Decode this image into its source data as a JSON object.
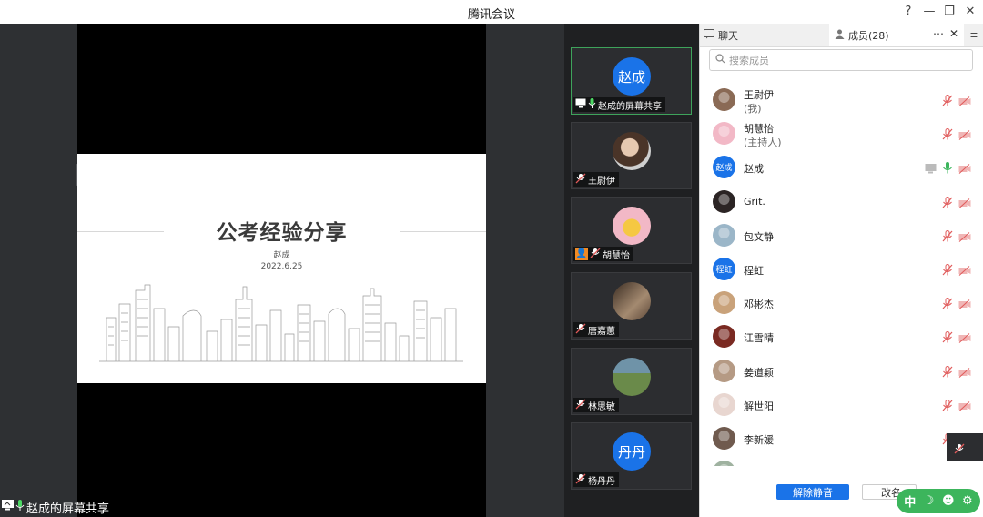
{
  "window": {
    "title": "腾讯会议"
  },
  "slide": {
    "title": "公考经验分享",
    "author": "赵成",
    "date": "2022.6.25"
  },
  "share_label": "赵成的屏幕共享",
  "gallery": [
    {
      "name": "赵成的屏幕共享",
      "avatar_text": "赵成",
      "avatar_color": "#1a73e8",
      "kind": "initials",
      "active": true,
      "mic": "on",
      "screen_icon": true
    },
    {
      "name": "王尉伊",
      "kind": "photo",
      "photo_color": "#8a6a55",
      "mic": "muted"
    },
    {
      "name": "胡慧怡",
      "kind": "photo",
      "photo_color": "#f2b8c6",
      "mic": "muted",
      "person_icon": true
    },
    {
      "name": "唐嘉蕙",
      "kind": "photo",
      "photo_color": "#6d5744",
      "mic": "muted"
    },
    {
      "name": "林思敏",
      "kind": "photo",
      "photo_color": "#8aa6b6",
      "mic": "muted"
    },
    {
      "name": "杨丹丹",
      "avatar_text": "丹丹",
      "avatar_color": "#1a73e8",
      "kind": "initials",
      "mic": "muted"
    }
  ],
  "panel": {
    "tab_chat": "聊天",
    "tab_members": "成员(28)",
    "more_icon": "more-icon",
    "search_placeholder": "搜索成员",
    "members": [
      {
        "name": "王尉伊",
        "sub": "(我)",
        "kind": "photo",
        "color": "#8a6a55",
        "mic": "muted",
        "cam": "off"
      },
      {
        "name": "胡慧怡",
        "sub": "(主持人)",
        "kind": "photo",
        "color": "#f2b8c6",
        "mic": "muted",
        "cam": "off"
      },
      {
        "name": "赵成",
        "kind": "initials",
        "avatar_text": "赵成",
        "color": "#1a73e8",
        "mic": "on",
        "cam": "off",
        "sharing": true
      },
      {
        "name": "Grit.",
        "kind": "photo",
        "color": "#2b2424",
        "mic": "muted",
        "cam": "off"
      },
      {
        "name": "包文静",
        "kind": "photo",
        "color": "#9bb6c8",
        "mic": "muted",
        "cam": "off"
      },
      {
        "name": "程虹",
        "kind": "initials",
        "avatar_text": "程虹",
        "color": "#1a73e8",
        "mic": "muted",
        "cam": "off"
      },
      {
        "name": "邓彬杰",
        "kind": "photo",
        "color": "#c9a27a",
        "mic": "muted",
        "cam": "off"
      },
      {
        "name": "江雪晴",
        "kind": "photo",
        "color": "#7a2a22",
        "mic": "muted",
        "cam": "off"
      },
      {
        "name": "姜道颖",
        "kind": "photo",
        "color": "#b59a84",
        "mic": "muted",
        "cam": "off"
      },
      {
        "name": "解世阳",
        "kind": "photo",
        "color": "#e8d6d0",
        "mic": "muted",
        "cam": "off"
      },
      {
        "name": "李新媛",
        "kind": "photo",
        "color": "#6f5a4e",
        "mic": "muted",
        "cam": "off"
      },
      {
        "name": "",
        "kind": "photo",
        "color": "#9fb2a0",
        "mic": "muted",
        "cam": "off"
      }
    ],
    "unmute_all": "解除静音",
    "rename": "改名"
  },
  "float_bar": {
    "items": [
      "中",
      "☽",
      "☻",
      "⚙"
    ]
  },
  "colors": {
    "accent": "#1a73e8",
    "green": "#3cb55c",
    "muted_red": "#e05a5a"
  }
}
